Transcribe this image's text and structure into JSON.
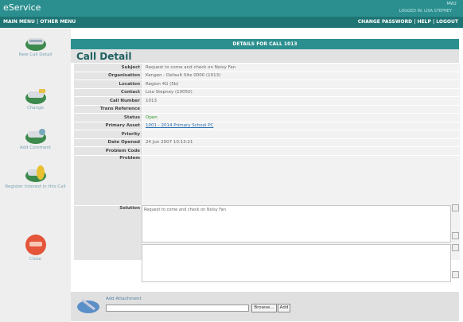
{
  "app": {
    "title": "eService",
    "version": "MW2",
    "logged_in_as": "LOGGED IN: LISA STEPNEY"
  },
  "menu": {
    "main": "MAIN MENU",
    "sep": "|",
    "other": "OTHER MENU",
    "change_password": "CHANGE PASSWORD",
    "help": "HELP",
    "logout": "LOGOUT"
  },
  "sidebar": [
    {
      "label": "New Call Detail",
      "icon": "phone-arrow-icon"
    },
    {
      "label": "Change",
      "icon": "phone-edit-icon"
    },
    {
      "label": "Add Comment",
      "icon": "phone-comment-icon"
    },
    {
      "label": "Register Interest in this Call",
      "icon": "phone-register-icon"
    },
    {
      "label": "Close",
      "icon": "phone-close-icon"
    }
  ],
  "header": {
    "details_bar": "DETAILS FOR CALL 1013",
    "page_title": "Call Detail"
  },
  "fields": [
    {
      "label": "Subject",
      "value": "Request to come and check on Noisy Fan"
    },
    {
      "label": "Organisation",
      "value": "Kengen - Default Site 0000 (1013)"
    },
    {
      "label": "Location",
      "value": "Region 4G (5b)"
    },
    {
      "label": "Contact",
      "value": "Lisa Stepney (10050)"
    },
    {
      "label": "Call Number",
      "value": "1013"
    },
    {
      "label": "Trans Reference",
      "value": ""
    },
    {
      "label": "Status",
      "value": "Open"
    },
    {
      "label": "Primary Asset",
      "value": "1001 - 2014 Primary School PC"
    },
    {
      "label": "Priority",
      "value": ""
    },
    {
      "label": "Date Opened",
      "value": "24 Jun 2007 10:13:21"
    },
    {
      "label": "Problem Code",
      "value": ""
    }
  ],
  "problem": {
    "label": "Problem",
    "value": "Request to come and check on Noisy Fan"
  },
  "solution": {
    "label": "Solution",
    "value": ""
  },
  "attachment": {
    "label": "Add Attachment",
    "browse": "Browse...",
    "add": "Add"
  },
  "colors": {
    "topbar": "#2c8f8f",
    "menubar": "#1f7474",
    "accent_link": "#2a6fb0",
    "status_open": "#2c9a2c"
  }
}
